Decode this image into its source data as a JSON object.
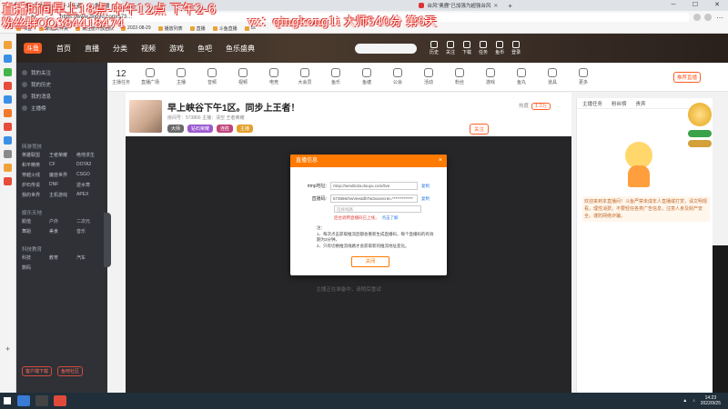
{
  "overlay": {
    "line1": "直播时间早上18点-中午12点 下午2-6",
    "line2": "粉丝群QQ384418474",
    "line3": "vx：qingkong1i  大师540分 第6天"
  },
  "browser": {
    "tabs": [
      {
        "label": "早上峡谷下午1区，同步上王者！- 斗鱼直播"
      },
      {
        "label": "台风\"奥鹿\"已加强为超强台风"
      }
    ],
    "url": "https://www.douyu.com/573…",
    "bookmarks": [
      "书签",
      "新建文件夹",
      "请注册开放团队",
      "2022-08-29",
      "播放列表",
      "直播",
      "斗鱼直播",
      "cs"
    ]
  },
  "site": {
    "logo": "斗鱼",
    "nav": [
      "首页",
      "直播",
      "分类",
      "视频",
      "游戏",
      "鱼吧",
      "鱼乐盛典"
    ],
    "search_placeholder": "",
    "header_icons": [
      "历史",
      "关注",
      "下载",
      "任务",
      "鱼币",
      "登录"
    ]
  },
  "sidebar": {
    "top_items": [
      "我的关注",
      "我的历史",
      "我的消息",
      "主播榜"
    ],
    "game_grp": "网游竞技",
    "game_items": [
      "英雄联盟",
      "王者荣耀",
      "绝地求生",
      "和平精英",
      "CF",
      "DOTA2",
      "穿越火线",
      "魔兽世界",
      "CSGO",
      "炉石传说",
      "DNF",
      "逆水寒",
      "我的世界",
      "主机游戏",
      "APEX"
    ],
    "ent_grp": "娱乐天地",
    "ent_items": [
      "颜值",
      "户外",
      "二次元",
      "舞蹈",
      "美食",
      "音乐"
    ],
    "other_grp": "科技教育",
    "other_items": [
      "科技",
      "教育",
      "汽车",
      "数码"
    ],
    "foot": [
      "客户端下载",
      "鱼吧社区"
    ]
  },
  "categories": {
    "count": "12",
    "count_label": "主播任务",
    "items": [
      "直播广场",
      "主播",
      "音频",
      "视频",
      "电竞",
      "大会员",
      "鱼乐",
      "鱼塘",
      "公会",
      "活动",
      "粉丝",
      "游戏",
      "鱼丸",
      "道具",
      "更多"
    ],
    "recommend": "推荐直播"
  },
  "room": {
    "title": "早上峡谷下午1区。同步上王者！",
    "meta": "房间号：573866  主播：清空  王者荣耀",
    "tags": [
      "大师",
      "钻石荣耀",
      "连胜",
      "主播"
    ],
    "follow": "关注",
    "heat_label": "热度",
    "heat_badge": "1.2万"
  },
  "dialog": {
    "title": "直播信息",
    "rtmp_label": "rtmp地址:",
    "rtmp_value": "rtmp://sendtc3a.douyu.com/live",
    "key_label": "直播码:",
    "key_value": "573866rhwVeeddhTw3xxsecret=*************",
    "copy1": "复制",
    "copy2": "复制",
    "select_hint": "选择线路",
    "warn": "后台调用直播码已上线，",
    "warn_link": "点击了解",
    "note_head": "注：",
    "note1": "1、每次点击获取推流后都会重新生成直播码，每个直播码的有效期为3分钟。",
    "note2": "2、只有切换推流线路才会获取新的推流地址变化。",
    "close": "关闭"
  },
  "video": {
    "note": "主播正在准备中，请稍后重试"
  },
  "chat": {
    "tabs": [
      "主播任务",
      "粉丝榜",
      "贵宾"
    ],
    "notice": "欢迎来到本直播间！斗鱼严禁未成年人直播或打赏，请文明观看，理性消费，不要轻信各类广告信息，注意人身及财产安全。谨防网络诈骗。"
  },
  "taskbar": {
    "time": "14:23",
    "date": "2022/9/25"
  }
}
